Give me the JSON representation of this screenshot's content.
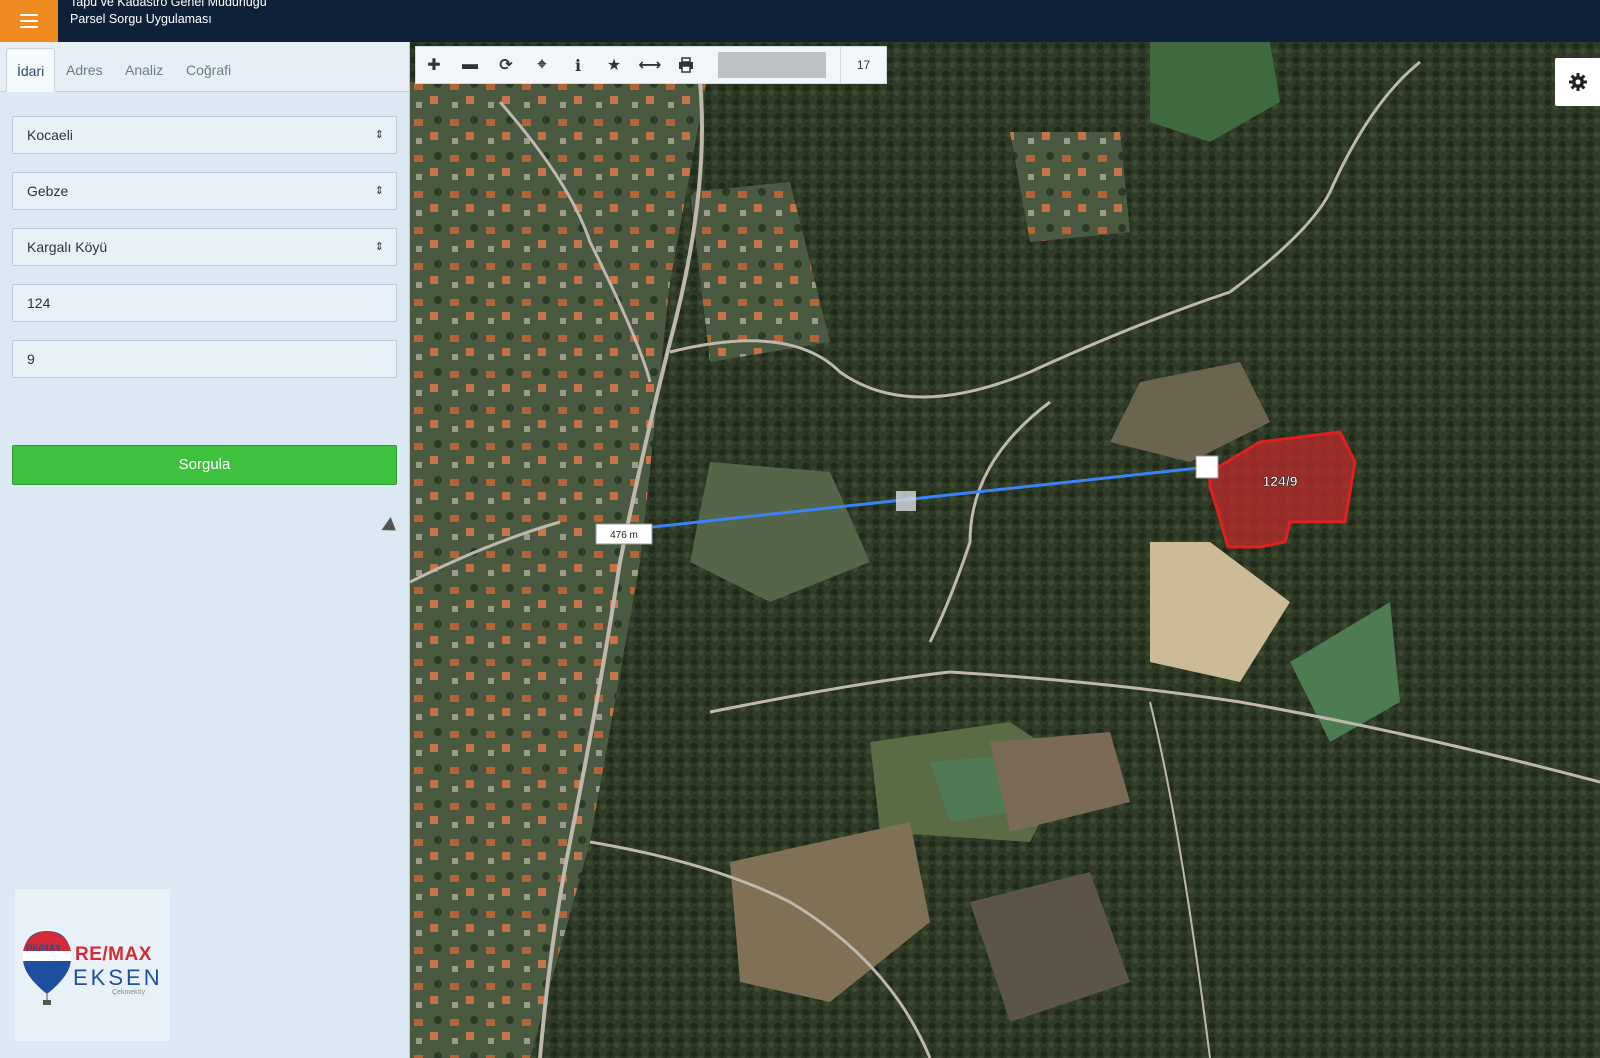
{
  "header": {
    "title_line1": "Tapu ve Kadastro Genel Müdürlüğü",
    "title_line2": "Parsel Sorgu Uygulaması"
  },
  "sidebar": {
    "tabs": [
      {
        "label": "İdari",
        "active": true
      },
      {
        "label": "Adres",
        "active": false
      },
      {
        "label": "Analiz",
        "active": false
      },
      {
        "label": "Coğrafi",
        "active": false
      }
    ],
    "fields": {
      "province": "Kocaeli",
      "district": "Gebze",
      "neighborhood": "Kargalı Köyü",
      "block": "124",
      "parcel": "9"
    },
    "query_button": "Sorgula",
    "logo": {
      "brand": "RE/MAX",
      "brand_badge": "RE/MAX",
      "office": "EKSEN",
      "sub": "Çekmeköy"
    }
  },
  "map": {
    "zoom_level": "17",
    "measure_label": "476 m",
    "parcel_label": "124/9",
    "colors": {
      "parcel_fill": "#b52a2a",
      "measure_line": "#3b82f6"
    },
    "toolbar_icons": [
      "plus-icon",
      "minus-icon",
      "refresh-icon",
      "crosshair-icon",
      "info-icon",
      "star-icon",
      "measure-icon",
      "print-icon"
    ]
  },
  "colors": {
    "header_bg": "#0f2138",
    "menu_accent": "#ef8a1e",
    "button_green": "#3ec13e",
    "sidebar_bg": "#dce9f5"
  }
}
